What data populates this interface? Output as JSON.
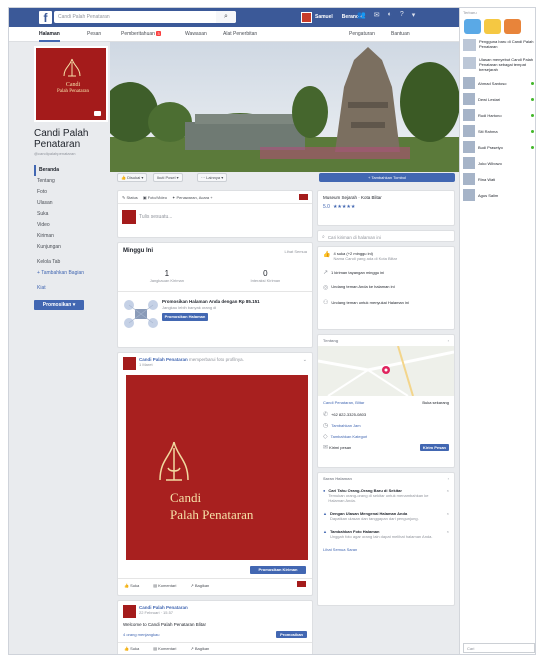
{
  "topbar": {
    "search_value": "Candi Palah Penataran",
    "user_name": "Samuel",
    "home_label": "Beranda"
  },
  "nav": {
    "tabs": [
      "Halaman",
      "Pesan",
      "Pemberitahuan",
      "Wawasan",
      "Alat Penerbitan"
    ],
    "notif_count": "3",
    "right_tabs": [
      "Pengaturan",
      "Bantuan"
    ]
  },
  "page": {
    "name": "Candi Palah Penataran",
    "handle": "@candipalahpenataran",
    "logo_text": [
      "Candi",
      "Palah Penataran"
    ],
    "left_nav": [
      "Beranda",
      "Tentang",
      "Foto",
      "Ulasan",
      "Suka",
      "Video",
      "Kiriman",
      "Kunjungan"
    ],
    "left_links": [
      "Kelola Tab",
      "Tambahkan Bagian"
    ],
    "events_label": "Kiat",
    "promote": "Promosikan"
  },
  "actions": {
    "liked": "Disukai",
    "following": "Ikuti Posel",
    "share": "Lainnya",
    "cta": "+ Tambahkan Tombol"
  },
  "composer": {
    "tabs": [
      "Status",
      "Foto/Video",
      "Penawaran, Acara +"
    ],
    "placeholder": "Tulis sesuatu..."
  },
  "week": {
    "title": "Minggu Ini",
    "see_all": "Lihat Semua",
    "stats": [
      {
        "value": "1",
        "label": "Jangkauan Kiriman"
      },
      {
        "value": "0",
        "label": "Interaksi Kiriman"
      }
    ],
    "promo_title": "Promosikan Halaman Anda dengan Rp 85.151",
    "promo_desc": "Jangkau lebih banyak orang di",
    "promo_btn": "Promosikan Halaman"
  },
  "post1": {
    "author": "Candi Palah Penataran",
    "action": "memperbarui foto profilnya.",
    "time": "1 Maret",
    "image_text": [
      "Candi",
      "Palah Penataran"
    ],
    "boost": "Promosikan Kiriman",
    "actions": [
      "Suka",
      "Komentari",
      "Bagikan"
    ]
  },
  "post2": {
    "author": "Candi Palah Penataran",
    "time": "22 Februari · 15.57",
    "text": "Welcome to Candi Palah Penataran Blitar",
    "reach": "4 orang menjangkau",
    "boost": "Promosikan",
    "actions": [
      "Suka",
      "Komentari",
      "Bagikan"
    ]
  },
  "about": {
    "category": "Museum Sejarah · Kota Blitar",
    "rating": "5.0",
    "stars": "★★★★★",
    "search_placeholder": "Cari kiriman di halaman ini",
    "facts": [
      "4 suka (+2 minggu ini)",
      "Nama Candi yang ada di Kota Blitar",
      "1 kiriman tayangan minggu ini",
      "Undang teman Anda ke halaman ini",
      "Undang teman untuk menyukai Halaman ini"
    ]
  },
  "map": {
    "title": "Tentang",
    "address": "Candi Penataran, Blitar",
    "hours_label": "Buka sekarang",
    "phone": "+62 822-3325-0803",
    "items": [
      "Tambahkan Jam",
      "Tambahkan Kategori",
      "Kirimi pesan"
    ],
    "msg_btn": "Kirim Pesan"
  },
  "suggestions": {
    "title": "Saran Halaman",
    "items": [
      {
        "title": "Cari Tahu Orang-Orang Baru di Sekitar",
        "desc": "Temukan orang-orang di sekitar untuk menambahkan ke Halaman Anda."
      },
      {
        "title": "Dengan Ulasan Mengenai Halaman Anda",
        "desc": "Dapatkan ulasan dan tanggapan dari pengunjung."
      },
      {
        "title": "Tambahkan Foto Halaman",
        "desc": "Unggah foto agar orang lain dapat melihat halaman Anda."
      }
    ],
    "see_all": "Lihat Semua Saran"
  },
  "chat": {
    "section_label": "Terbaru",
    "news": [
      {
        "text": "Pengguna baru di Candi Palah Penataran"
      },
      {
        "text": "Ulasan menyebut Candi Palah Penataran sebagai tempat bersejarah"
      }
    ],
    "contacts": [
      {
        "name": "Ahmad Santoso",
        "online": true
      },
      {
        "name": "Dewi Lestari",
        "online": true
      },
      {
        "name": "Rudi Hartono",
        "online": true
      },
      {
        "name": "Siti Rahma",
        "online": true
      },
      {
        "name": "Budi Prasetyo",
        "online": true
      },
      {
        "name": "Joko Wibowo",
        "online": false
      },
      {
        "name": "Rina Wati",
        "online": false
      },
      {
        "name": "Agus Salim",
        "online": false
      }
    ],
    "search_placeholder": "Cari"
  }
}
